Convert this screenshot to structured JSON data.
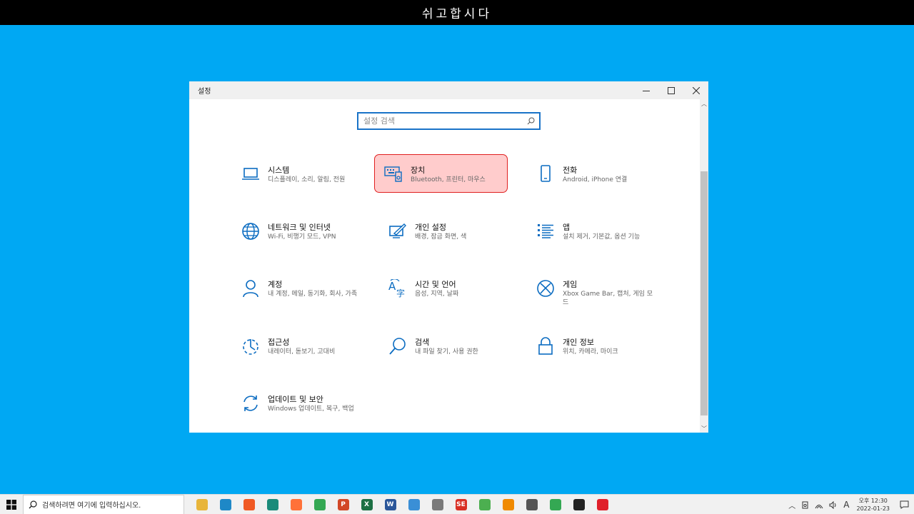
{
  "banner": {
    "text": "쉬고합시다"
  },
  "window": {
    "title": "설정",
    "controls": {
      "minimize_icon": "minimize-icon",
      "maximize_icon": "maximize-icon",
      "close_icon": "close-icon"
    }
  },
  "search": {
    "placeholder": "설정 검색",
    "icon": "search-icon"
  },
  "tiles": [
    {
      "title": "시스템",
      "desc": "디스플레이, 소리, 알림, 전원",
      "icon": "laptop-icon"
    },
    {
      "title": "장치",
      "desc": "Bluetooth, 프린터, 마우스",
      "icon": "keyboard-devices-icon",
      "selected": true
    },
    {
      "title": "전화",
      "desc": "Android, iPhone 연결",
      "icon": "phone-icon"
    },
    {
      "title": "네트워크 및 인터넷",
      "desc": "Wi-Fi, 비행기 모드, VPN",
      "icon": "globe-icon"
    },
    {
      "title": "개인 설정",
      "desc": "배경, 잠금 화면, 색",
      "icon": "personalization-icon"
    },
    {
      "title": "앱",
      "desc": "설치 제거, 기본값, 옵션 기능",
      "icon": "apps-list-icon"
    },
    {
      "title": "계정",
      "desc": "내 계정, 메일, 동기화, 회사, 가족",
      "icon": "person-icon"
    },
    {
      "title": "시간 및 언어",
      "desc": "음성, 지역, 날짜",
      "icon": "time-language-icon"
    },
    {
      "title": "게임",
      "desc": "Xbox Game Bar, 캡처, 게임 모드",
      "icon": "xbox-icon"
    },
    {
      "title": "접근성",
      "desc": "내레이터, 돋보기, 고대비",
      "icon": "accessibility-icon"
    },
    {
      "title": "검색",
      "desc": "내 파일 찾기, 사용 권한",
      "icon": "magnifier-icon"
    },
    {
      "title": "개인 정보",
      "desc": "위치, 카메라, 마이크",
      "icon": "lock-icon"
    },
    {
      "title": "업데이트 및 보안",
      "desc": "Windows 업데이트, 복구, 백업",
      "icon": "update-icon"
    }
  ],
  "taskbar": {
    "search_placeholder": "검색하려면 여기에 입력하십시오.",
    "apps": [
      {
        "name": "file-explorer-icon",
        "color": "#e8b53a"
      },
      {
        "name": "edge-icon",
        "color": "#1e88c7"
      },
      {
        "name": "brave-icon",
        "color": "#f05a24"
      },
      {
        "name": "app-teal-icon",
        "color": "#1a8b7a"
      },
      {
        "name": "firefox-icon",
        "color": "#ff7139"
      },
      {
        "name": "chrome-icon",
        "color": "#34a853"
      },
      {
        "name": "powerpoint-icon",
        "color": "#d24726",
        "label": "P"
      },
      {
        "name": "excel-icon",
        "color": "#1d7044",
        "label": "X"
      },
      {
        "name": "word-icon",
        "color": "#2b579a",
        "label": "W"
      },
      {
        "name": "app-blue-icon",
        "color": "#3a8fd6"
      },
      {
        "name": "app-gray-icon",
        "color": "#7a7a7a"
      },
      {
        "name": "app-red-icon",
        "color": "#d93025",
        "label": "SE"
      },
      {
        "name": "app-green-icon",
        "color": "#4caf50"
      },
      {
        "name": "vlc-icon",
        "color": "#f08a00"
      },
      {
        "name": "calculator-icon",
        "color": "#555555"
      },
      {
        "name": "app-chrome2-icon",
        "color": "#34a853"
      },
      {
        "name": "sticky-icon",
        "color": "#222222"
      },
      {
        "name": "opera-icon",
        "color": "#e0202a"
      }
    ],
    "tray": {
      "ime": "A"
    },
    "clock": {
      "time": "오후 12:30",
      "date": "2022-01-23"
    }
  },
  "colors": {
    "desktop": "#00a8f3",
    "accent": "#1a73c8",
    "selected_bg": "#ffcccc",
    "selected_border": "#e02020"
  }
}
